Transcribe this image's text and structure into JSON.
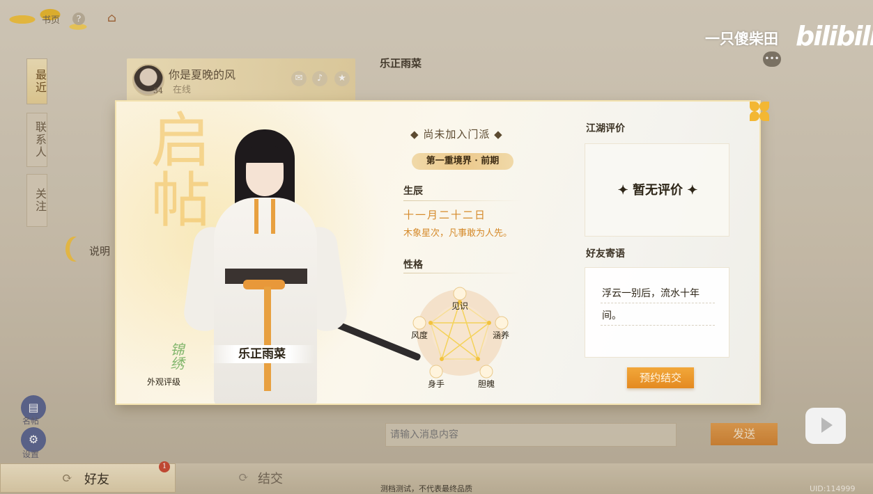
{
  "background": {
    "top_title": "书页",
    "sidebar_tabs": [
      "最近",
      "联系人",
      "关注"
    ],
    "friend": {
      "name": "你是夏晚的风",
      "level": "34",
      "status": "在线"
    },
    "chat_title": "乐正雨菜",
    "hint_label": "说明",
    "left_buttons": [
      {
        "label": "名帖"
      },
      {
        "label": "设置"
      }
    ],
    "message_placeholder": "请输入消息内容",
    "send_label": "发送",
    "bottom_tabs": {
      "friends": "好友",
      "friends_badge": "1",
      "jiejiao": "结交"
    },
    "notice": "测档测试，不代表最终品质",
    "uid": "UID:114999"
  },
  "watermark": {
    "uploader": "一只傻柴田",
    "logo": "bilibili"
  },
  "profile": {
    "calligraphy": "启帖",
    "character_name": "乐正雨菜",
    "appearance_rating_badge": "锦绣",
    "appearance_rating_label": "外观评级",
    "sect": "尚未加入门派",
    "realm": "第一重境界 · 前期",
    "birthday": {
      "title": "生辰",
      "date": "十一月二十二日",
      "desc": "木象星次，凡事敢为人先。"
    },
    "personality": {
      "title": "性格",
      "axes": [
        "见识",
        "涵养",
        "胆魄",
        "身手",
        "风度"
      ]
    },
    "review": {
      "title": "江湖评价",
      "text": "暂无评价"
    },
    "note": {
      "title": "好友寄语",
      "line1": "浮云一别后，流水十年",
      "line2": "间。"
    },
    "appointment_button": "预约结交"
  },
  "colors": {
    "accent_orange": "#e48a20",
    "text_orange": "#d58a2a",
    "gold": "#f3b733"
  }
}
